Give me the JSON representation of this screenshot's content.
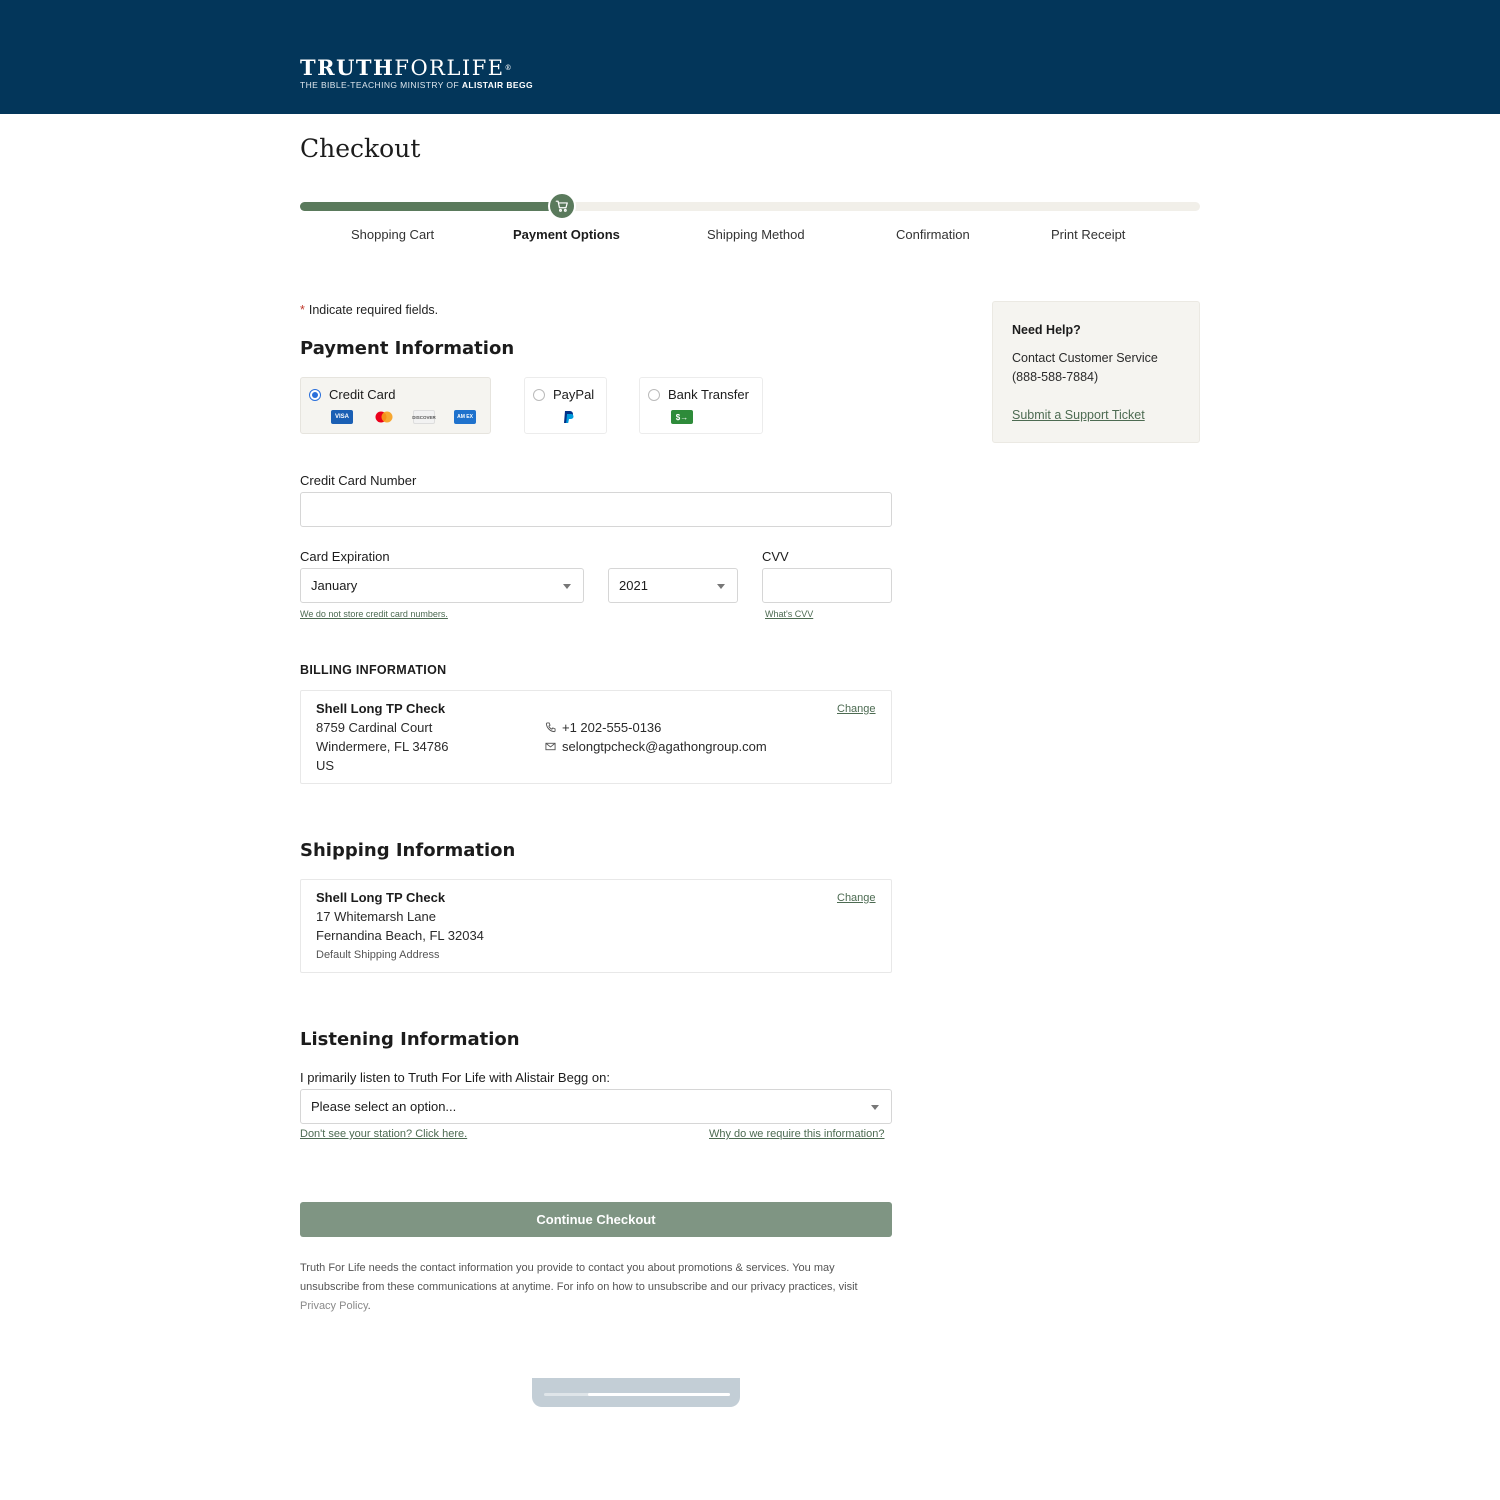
{
  "brand": {
    "logo_bold": "TRUTH",
    "logo_light": "FORLIFE",
    "logo_mark": "®",
    "tagline_prefix": "THE BIBLE-TEACHING MINISTRY OF ",
    "tagline_bold": "ALISTAIR BEGG",
    "header_color": "#03365a",
    "accent_color": "#5a7a5c"
  },
  "page": {
    "title": "Checkout"
  },
  "progress": {
    "steps": [
      "Shopping Cart",
      "Payment Options",
      "Shipping Method",
      "Confirmation",
      "Print Receipt"
    ],
    "active_step": "Payment Options",
    "knob_icon": "cart-icon"
  },
  "required_note": {
    "star": "*",
    "text": "Indicate required fields."
  },
  "payment": {
    "title": "Payment Information",
    "options": [
      {
        "label": "Credit Card",
        "selected": true,
        "icons": [
          "visa-icon",
          "mastercard-icon",
          "discover-icon",
          "amex-icon"
        ]
      },
      {
        "label": "PayPal",
        "selected": false,
        "icons": [
          "paypal-icon"
        ]
      },
      {
        "label": "Bank Transfer",
        "selected": false,
        "icons": [
          "bank-transfer-icon"
        ]
      }
    ],
    "card_logos": {
      "visa": "VISA",
      "discover": "DISCOVER",
      "amex": "AM EX",
      "bank": "$→"
    },
    "card_number_label": "Credit Card Number",
    "card_number_value": "",
    "expiration_label": "Card Expiration",
    "exp_month": "January",
    "exp_year": "2021",
    "cvv_label": "CVV",
    "cvv_value": "",
    "no_store_link": "We do not store credit card numbers.",
    "whats_cvv_link": "What's CVV"
  },
  "billing": {
    "title": "BILLING INFORMATION",
    "name": "Shell Long TP Check",
    "street": "8759 Cardinal Court",
    "city": "Windermere, FL 34786",
    "country": "US",
    "phone": "+1 202-555-0136",
    "email": "selongtpcheck@agathongroup.com",
    "change_link": "Change"
  },
  "shipping": {
    "title": "Shipping Information",
    "name": "Shell Long TP Check",
    "street": "17 Whitemarsh Lane",
    "city": "Fernandina Beach, FL 32034",
    "note": "Default Shipping Address",
    "change_link": "Change"
  },
  "listening": {
    "title": "Listening Information",
    "question": "I primarily listen to Truth For Life with Alistair Begg on:",
    "select_value": "Please select an option...",
    "station_link": "Don't see your station? Click here.",
    "why_link": "Why do we require this information?"
  },
  "actions": {
    "continue_label": "Continue Checkout"
  },
  "disclaimer": {
    "text": "Truth For Life needs the contact information you provide to contact you about promotions & services. You may unsubscribe from these communications at anytime. For info on how to unsubscribe and our privacy practices, visit ",
    "link": "Privacy Policy",
    "end": "."
  },
  "help": {
    "title": "Need Help?",
    "line1": "Contact Customer Service",
    "phone": "(888-588-7884)",
    "ticket_link": "Submit a Support Ticket"
  }
}
